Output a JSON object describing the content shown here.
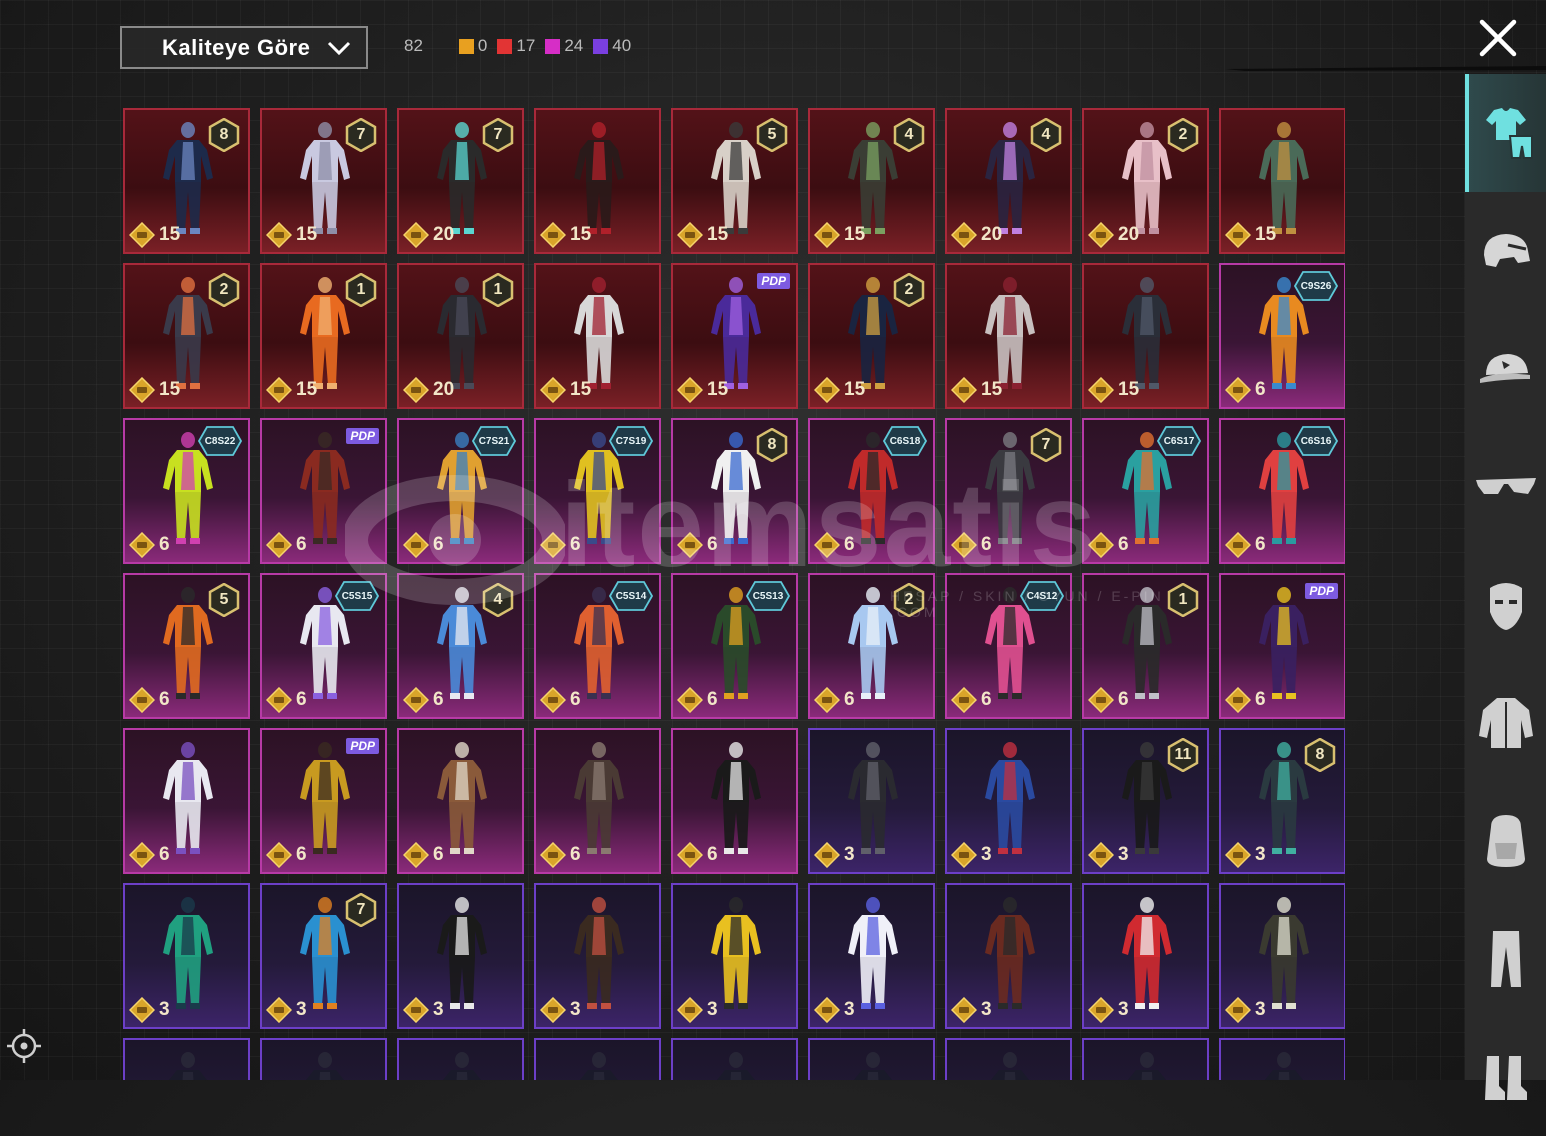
{
  "filter": {
    "selected": "Kaliteye Göre"
  },
  "stats": {
    "total": "82",
    "counts": [
      {
        "color": "#e8a020",
        "value": "0"
      },
      {
        "color": "#e23434",
        "value": "17"
      },
      {
        "color": "#d62ec6",
        "value": "24"
      },
      {
        "color": "#7a3fe0",
        "value": "40"
      }
    ]
  },
  "watermark": {
    "text": "itemsatis",
    "sub": "HESAP / SKIN / OYUN / E-PIN .COM"
  },
  "sidebar": {
    "tabs": [
      {
        "icon": "outfit-icon",
        "active": true
      },
      {
        "icon": "helmet-icon",
        "active": false
      },
      {
        "icon": "cap-icon",
        "active": false
      },
      {
        "icon": "glasses-icon",
        "active": false
      },
      {
        "icon": "mask-icon",
        "active": false
      },
      {
        "icon": "jacket-icon",
        "active": false
      },
      {
        "icon": "backpack-icon",
        "active": false
      },
      {
        "icon": "pants-icon",
        "active": false
      },
      {
        "icon": "shoes-icon",
        "active": false
      }
    ]
  },
  "items": [
    {
      "tier": "legendary",
      "cost": "15",
      "badge": "num",
      "badge_text": "8",
      "colors": [
        "#1d2a4a",
        "#6b86c0"
      ]
    },
    {
      "tier": "legendary",
      "cost": "15",
      "badge": "num",
      "badge_text": "7",
      "colors": [
        "#c9c9e0",
        "#8e8ea8"
      ]
    },
    {
      "tier": "legendary",
      "cost": "20",
      "badge": "num",
      "badge_text": "7",
      "colors": [
        "#2a2a2a",
        "#5ad6d0"
      ]
    },
    {
      "tier": "legendary",
      "cost": "15",
      "badge": "",
      "badge_text": "",
      "colors": [
        "#2a1a1a",
        "#b0202a"
      ]
    },
    {
      "tier": "legendary",
      "cost": "15",
      "badge": "num",
      "badge_text": "5",
      "colors": [
        "#d8d0c8",
        "#3a3a3a"
      ]
    },
    {
      "tier": "legendary",
      "cost": "15",
      "badge": "num",
      "badge_text": "4",
      "colors": [
        "#3a3d34",
        "#7aa060"
      ]
    },
    {
      "tier": "legendary",
      "cost": "20",
      "badge": "num",
      "badge_text": "4",
      "colors": [
        "#2a2440",
        "#c080e0"
      ]
    },
    {
      "tier": "legendary",
      "cost": "20",
      "badge": "num",
      "badge_text": "2",
      "colors": [
        "#e8c0c8",
        "#c090a0"
      ]
    },
    {
      "tier": "legendary",
      "cost": "15",
      "badge": "",
      "badge_text": "",
      "colors": [
        "#4a6a58",
        "#c09040"
      ]
    },
    {
      "tier": "legendary",
      "cost": "15",
      "badge": "num",
      "badge_text": "2",
      "colors": [
        "#3a3a4a",
        "#e07040"
      ]
    },
    {
      "tier": "legendary",
      "cost": "15",
      "badge": "num",
      "badge_text": "1",
      "colors": [
        "#e86a20",
        "#f0b070"
      ]
    },
    {
      "tier": "legendary",
      "cost": "20",
      "badge": "num",
      "badge_text": "1",
      "colors": [
        "#2a2a30",
        "#4a4a58"
      ]
    },
    {
      "tier": "legendary",
      "cost": "15",
      "badge": "",
      "badge_text": "",
      "colors": [
        "#d8d8d8",
        "#a02030"
      ]
    },
    {
      "tier": "legendary",
      "cost": "15",
      "badge": "pdp",
      "badge_text": "PDP",
      "colors": [
        "#4a2a9a",
        "#a060e0"
      ]
    },
    {
      "tier": "legendary",
      "cost": "15",
      "badge": "num",
      "badge_text": "2",
      "colors": [
        "#1a2440",
        "#d0a040"
      ]
    },
    {
      "tier": "legendary",
      "cost": "15",
      "badge": "",
      "badge_text": "",
      "colors": [
        "#c8c0c0",
        "#8a2030"
      ]
    },
    {
      "tier": "legendary",
      "cost": "15",
      "badge": "",
      "badge_text": "",
      "colors": [
        "#2a2e38",
        "#505868"
      ]
    },
    {
      "tier": "mythic",
      "cost": "6",
      "badge": "season",
      "badge_text": "C9S26",
      "colors": [
        "#e88a20",
        "#3a8ad0"
      ]
    },
    {
      "tier": "mythic",
      "cost": "6",
      "badge": "season",
      "badge_text": "C8S22",
      "colors": [
        "#c8e020",
        "#d040b0"
      ]
    },
    {
      "tier": "mythic",
      "cost": "6",
      "badge": "pdp",
      "badge_text": "PDP",
      "colors": [
        "#8a2a20",
        "#3a2a24"
      ]
    },
    {
      "tier": "mythic",
      "cost": "6",
      "badge": "season",
      "badge_text": "C7S21",
      "colors": [
        "#e0a030",
        "#3a80c0"
      ]
    },
    {
      "tier": "mythic",
      "cost": "6",
      "badge": "season",
      "badge_text": "C7S19",
      "colors": [
        "#e0c020",
        "#3a4a8a"
      ]
    },
    {
      "tier": "mythic",
      "cost": "6",
      "badge": "num",
      "badge_text": "8",
      "colors": [
        "#f0f0f0",
        "#3a6ad0"
      ]
    },
    {
      "tier": "mythic",
      "cost": "6",
      "badge": "season",
      "badge_text": "C6S18",
      "colors": [
        "#c02a2a",
        "#2a2a2a"
      ]
    },
    {
      "tier": "mythic",
      "cost": "6",
      "badge": "num",
      "badge_text": "7",
      "colors": [
        "#3a3a40",
        "#7a7a80"
      ]
    },
    {
      "tier": "mythic",
      "cost": "6",
      "badge": "season",
      "badge_text": "C6S17",
      "colors": [
        "#2aa0a0",
        "#e07030"
      ]
    },
    {
      "tier": "mythic",
      "cost": "6",
      "badge": "season",
      "badge_text": "C6S16",
      "colors": [
        "#e04040",
        "#2a9aa0"
      ]
    },
    {
      "tier": "mythic",
      "cost": "6",
      "badge": "num",
      "badge_text": "5",
      "colors": [
        "#e06a20",
        "#2a2a2a"
      ]
    },
    {
      "tier": "mythic",
      "cost": "6",
      "badge": "season",
      "badge_text": "C5S15",
      "colors": [
        "#e8e8f0",
        "#8a60e0"
      ]
    },
    {
      "tier": "mythic",
      "cost": "6",
      "badge": "num",
      "badge_text": "4",
      "colors": [
        "#4a8ad8",
        "#e8e8f0"
      ]
    },
    {
      "tier": "mythic",
      "cost": "6",
      "badge": "season",
      "badge_text": "C5S14",
      "colors": [
        "#e06030",
        "#3a3050"
      ]
    },
    {
      "tier": "mythic",
      "cost": "6",
      "badge": "season",
      "badge_text": "C5S13",
      "colors": [
        "#2a4a2a",
        "#e0a020"
      ]
    },
    {
      "tier": "mythic",
      "cost": "6",
      "badge": "num",
      "badge_text": "2",
      "colors": [
        "#a8c8f0",
        "#e8f0f8"
      ]
    },
    {
      "tier": "mythic",
      "cost": "6",
      "badge": "season",
      "badge_text": "C4S12",
      "colors": [
        "#e05090",
        "#2a2a2a"
      ]
    },
    {
      "tier": "mythic",
      "cost": "6",
      "badge": "num",
      "badge_text": "1",
      "colors": [
        "#2a2a2a",
        "#c0c0c8"
      ]
    },
    {
      "tier": "mythic",
      "cost": "6",
      "badge": "pdp",
      "badge_text": "PDP",
      "colors": [
        "#3a2060",
        "#e8c020"
      ]
    },
    {
      "tier": "mythic",
      "cost": "6",
      "badge": "",
      "badge_text": "",
      "colors": [
        "#e8e8f0",
        "#7a50c0"
      ]
    },
    {
      "tier": "mythic",
      "cost": "6",
      "badge": "pdp",
      "badge_text": "PDP",
      "colors": [
        "#c89a20",
        "#3a2a20"
      ]
    },
    {
      "tier": "mythic",
      "cost": "6",
      "badge": "",
      "badge_text": "",
      "colors": [
        "#8a5a3a",
        "#e0d8c8"
      ]
    },
    {
      "tier": "mythic",
      "cost": "6",
      "badge": "",
      "badge_text": "",
      "colors": [
        "#4a3a34",
        "#8a7a70"
      ]
    },
    {
      "tier": "mythic",
      "cost": "6",
      "badge": "",
      "badge_text": "",
      "colors": [
        "#1a1a1a",
        "#e8e8e8"
      ]
    },
    {
      "tier": "epic",
      "cost": "3",
      "badge": "",
      "badge_text": "",
      "colors": [
        "#2a2a30",
        "#60606a"
      ]
    },
    {
      "tier": "epic",
      "cost": "3",
      "badge": "",
      "badge_text": "",
      "colors": [
        "#2a4aa0",
        "#c03040"
      ]
    },
    {
      "tier": "epic",
      "cost": "3",
      "badge": "num",
      "badge_text": "11",
      "colors": [
        "#1a1a1a",
        "#3a3a3a"
      ]
    },
    {
      "tier": "epic",
      "cost": "3",
      "badge": "num",
      "badge_text": "8",
      "colors": [
        "#2a3a40",
        "#40b0a0"
      ]
    },
    {
      "tier": "epic",
      "cost": "3",
      "badge": "",
      "badge_text": "",
      "colors": [
        "#20a080",
        "#1a3a4a"
      ]
    },
    {
      "tier": "epic",
      "cost": "3",
      "badge": "num",
      "badge_text": "7",
      "colors": [
        "#2a90d0",
        "#e08020"
      ]
    },
    {
      "tier": "epic",
      "cost": "3",
      "badge": "",
      "badge_text": "",
      "colors": [
        "#1a1a1a",
        "#e8e8e8"
      ]
    },
    {
      "tier": "epic",
      "cost": "3",
      "badge": "",
      "badge_text": "",
      "colors": [
        "#3a2a20",
        "#c05040"
      ]
    },
    {
      "tier": "epic",
      "cost": "3",
      "badge": "",
      "badge_text": "",
      "colors": [
        "#e8c020",
        "#2a2a2a"
      ]
    },
    {
      "tier": "epic",
      "cost": "3",
      "badge": "",
      "badge_text": "",
      "colors": [
        "#f0f0f8",
        "#5a60e0"
      ]
    },
    {
      "tier": "epic",
      "cost": "3",
      "badge": "",
      "badge_text": "",
      "colors": [
        "#6a2a20",
        "#2a2a2a"
      ]
    },
    {
      "tier": "epic",
      "cost": "3",
      "badge": "",
      "badge_text": "",
      "colors": [
        "#d02a30",
        "#f0f0f0"
      ]
    },
    {
      "tier": "epic",
      "cost": "3",
      "badge": "",
      "badge_text": "",
      "colors": [
        "#3a3a30",
        "#e0e0d0"
      ]
    },
    {
      "tier": "epic",
      "cost": "",
      "badge": "",
      "badge_text": "",
      "colors": [
        "#1a1a2a",
        "#2a2a3a"
      ]
    },
    {
      "tier": "epic",
      "cost": "",
      "badge": "",
      "badge_text": "",
      "colors": [
        "#1a1a2a",
        "#2a2a3a"
      ]
    },
    {
      "tier": "epic",
      "cost": "",
      "badge": "",
      "badge_text": "",
      "colors": [
        "#1a1a2a",
        "#2a2a3a"
      ]
    },
    {
      "tier": "epic",
      "cost": "",
      "badge": "",
      "badge_text": "",
      "colors": [
        "#1a1a2a",
        "#2a2a3a"
      ]
    },
    {
      "tier": "epic",
      "cost": "",
      "badge": "",
      "badge_text": "",
      "colors": [
        "#1a1a2a",
        "#2a2a3a"
      ]
    },
    {
      "tier": "epic",
      "cost": "",
      "badge": "",
      "badge_text": "",
      "colors": [
        "#1a1a2a",
        "#2a2a3a"
      ]
    },
    {
      "tier": "epic",
      "cost": "",
      "badge": "",
      "badge_text": "",
      "colors": [
        "#1a1a2a",
        "#2a2a3a"
      ]
    },
    {
      "tier": "epic",
      "cost": "",
      "badge": "",
      "badge_text": "",
      "colors": [
        "#1a1a2a",
        "#2a2a3a"
      ]
    },
    {
      "tier": "epic",
      "cost": "",
      "badge": "",
      "badge_text": "",
      "colors": [
        "#1a1a2a",
        "#2a2a3a"
      ]
    }
  ]
}
